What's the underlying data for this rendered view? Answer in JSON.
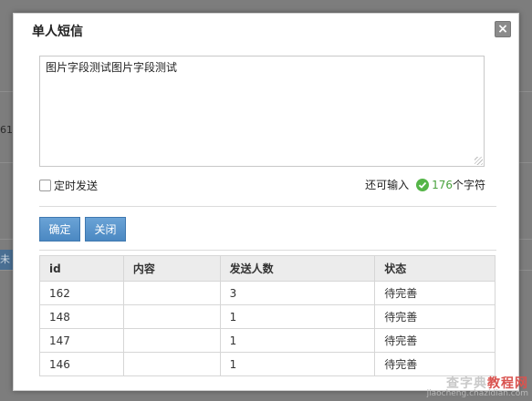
{
  "background": {
    "side_text": "61",
    "side_button_text": "未"
  },
  "dialog": {
    "title": "单人短信",
    "close_symbol": "×",
    "message_text": "图片字段测试图片字段测试",
    "timer_label": "定时发送",
    "counter_prefix": "还可输入",
    "counter_value": "176",
    "counter_suffix": "个字符",
    "confirm_label": "确定",
    "close_label": "关闭"
  },
  "table": {
    "headers": [
      "id",
      "内容",
      "发送人数",
      "状态"
    ],
    "rows": [
      [
        "162",
        "",
        "3",
        "待完善"
      ],
      [
        "148",
        "",
        "1",
        "待完善"
      ],
      [
        "147",
        "",
        "1",
        "待完善"
      ],
      [
        "146",
        "",
        "1",
        "待完善"
      ]
    ]
  },
  "watermark": {
    "line1_a": "查字典",
    "line1_b": "教程网",
    "line2": "jiaocheng.chazidian.com"
  },
  "colors": {
    "button_blue": "#4b88c2",
    "check_green": "#55b548",
    "overlay": "#7d7d7d"
  }
}
